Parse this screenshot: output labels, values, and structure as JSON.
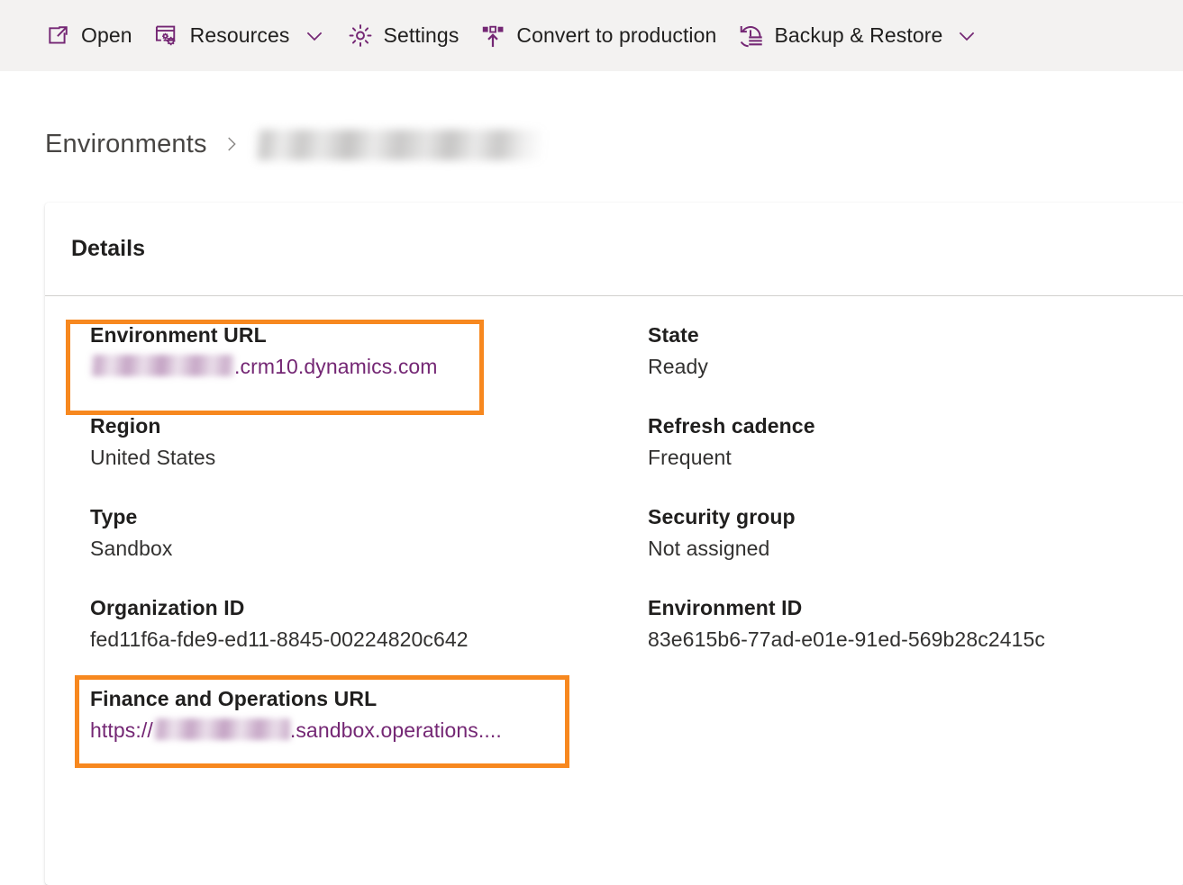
{
  "command_bar": {
    "items": [
      {
        "id": "open",
        "label": "Open",
        "icon": "open-in-new-window-icon",
        "has_chevron": false
      },
      {
        "id": "resources",
        "label": "Resources",
        "icon": "window-gears-icon",
        "has_chevron": true
      },
      {
        "id": "settings",
        "label": "Settings",
        "icon": "gear-icon",
        "has_chevron": false
      },
      {
        "id": "convert",
        "label": "Convert to production",
        "icon": "promote-upgrade-icon",
        "has_chevron": false
      },
      {
        "id": "backup",
        "label": "Backup & Restore",
        "icon": "restore-history-icon",
        "has_chevron": true
      }
    ]
  },
  "breadcrumb": {
    "root_label": "Environments",
    "separator": "chevron-right-icon",
    "current_label": ""
  },
  "card": {
    "title": "Details",
    "fields_left": [
      {
        "label": "Environment URL",
        "value_prefix": "",
        "value_redacted": true,
        "value_suffix": ".crm10.dynamics.com",
        "is_link": true,
        "highlighted": true
      },
      {
        "label": "Region",
        "value_prefix": "United States",
        "value_redacted": false,
        "value_suffix": "",
        "is_link": false,
        "highlighted": false
      },
      {
        "label": "Type",
        "value_prefix": "Sandbox",
        "value_redacted": false,
        "value_suffix": "",
        "is_link": false,
        "highlighted": false
      },
      {
        "label": "Organization ID",
        "value_prefix": "fed11f6a-fde9-ed11-8845-00224820c642",
        "value_redacted": false,
        "value_suffix": "",
        "is_link": false,
        "highlighted": false
      }
    ],
    "fields_right": [
      {
        "label": "State",
        "value_prefix": "Ready",
        "value_redacted": false,
        "value_suffix": "",
        "is_link": false,
        "highlighted": false
      },
      {
        "label": "Refresh cadence",
        "value_prefix": "Frequent",
        "value_redacted": false,
        "value_suffix": "",
        "is_link": false,
        "highlighted": false
      },
      {
        "label": "Security group",
        "value_prefix": "Not assigned",
        "value_redacted": false,
        "value_suffix": "",
        "is_link": false,
        "highlighted": false
      },
      {
        "label": "Environment ID",
        "value_prefix": "83e615b6-77ad-e01e-91ed-569b28c2415c",
        "value_redacted": false,
        "value_suffix": "",
        "is_link": false,
        "highlighted": false
      }
    ],
    "finance_ops": {
      "label": "Finance and Operations URL",
      "value_prefix": "https://",
      "value_redacted": true,
      "value_suffix": ".sandbox.operations....",
      "is_link": true,
      "highlighted": true
    }
  },
  "colors": {
    "command_bar_bg": "#f3f2f1",
    "icon_purple": "#742774",
    "link_purple": "#742774",
    "highlight_orange": "#f7881f",
    "divider": "#d2d0ce",
    "text_primary": "#201f1e",
    "breadcrumb_text": "#484644"
  }
}
